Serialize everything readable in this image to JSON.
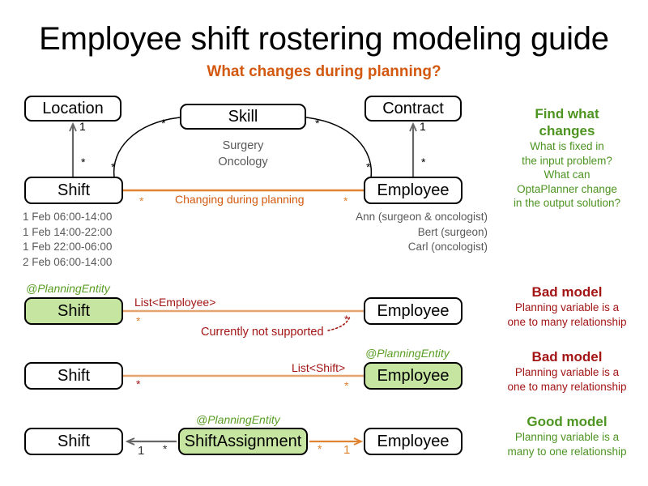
{
  "page": {
    "title": "Employee shift rostering modeling guide",
    "subtitle": "What changes during planning?"
  },
  "colors": {
    "orange": "#e08330",
    "orange_text": "#d2590f",
    "green": "#5a9e24",
    "green_head": "#4d9421",
    "red": "#a31515",
    "gray_line": "#666666",
    "green_fill": "#c6e5a0",
    "gray_text": "#595959"
  },
  "domain_model": {
    "boxes": {
      "location": "Location",
      "skill": "Skill",
      "contract": "Contract",
      "shift": "Shift",
      "employee": "Employee"
    },
    "skill_values": [
      "Surgery",
      "Oncology"
    ],
    "shift_instances": [
      "1 Feb 06:00-14:00",
      "1 Feb 14:00-22:00",
      "1 Feb 22:00-06:00",
      "2 Feb 06:00-14:00"
    ],
    "employee_instances": [
      "Ann (surgeon & oncologist)",
      "Bert (surgeon)",
      "Carl (oncologist)"
    ],
    "multiplicities": {
      "shift_location_many": "*",
      "shift_location_one": "1",
      "shift_skill_many": "*",
      "skill_shift_many": "*",
      "skill_employee_many": "*",
      "employee_skill_many": "*",
      "employee_contract_many": "*",
      "employee_contract_one": "1",
      "shift_employee_many": "*",
      "employee_shift_many": "*"
    },
    "changing_label": "Changing during planning"
  },
  "callouts": {
    "find_what_changes": {
      "head_line1": "Find what",
      "head_line2": "changes",
      "body_lines": [
        "What is fixed in",
        "the input problem?",
        "What can",
        "OptaPlanner change",
        "in the output solution?"
      ]
    },
    "bad_model_1": {
      "head": "Bad model",
      "body_lines": [
        "Planning variable is a",
        "one to many relationship"
      ]
    },
    "bad_model_2": {
      "head": "Bad model",
      "body_lines": [
        "Planning variable is a",
        "one to many relationship"
      ]
    },
    "good_model": {
      "head": "Good model",
      "body_lines": [
        "Planning variable is a",
        "many to one relationship"
      ]
    }
  },
  "model_rows": {
    "bad1": {
      "annotation": "@PlanningEntity",
      "left_box": "Shift",
      "right_box": "Employee",
      "edge_label": "List<Employee>",
      "left_mult": "*",
      "right_mult": "*",
      "note": "Currently not supported"
    },
    "bad2": {
      "annotation": "@PlanningEntity",
      "left_box": "Shift",
      "right_box": "Employee",
      "edge_label": "List<Shift>",
      "left_mult": "*",
      "right_mult": "*"
    },
    "good": {
      "annotation": "@PlanningEntity",
      "left_box": "Shift",
      "middle_box": "ShiftAssignment",
      "right_box": "Employee",
      "left_mult_one": "1",
      "left_mult_many": "*",
      "right_mult_many": "*",
      "right_mult_one": "1"
    }
  }
}
